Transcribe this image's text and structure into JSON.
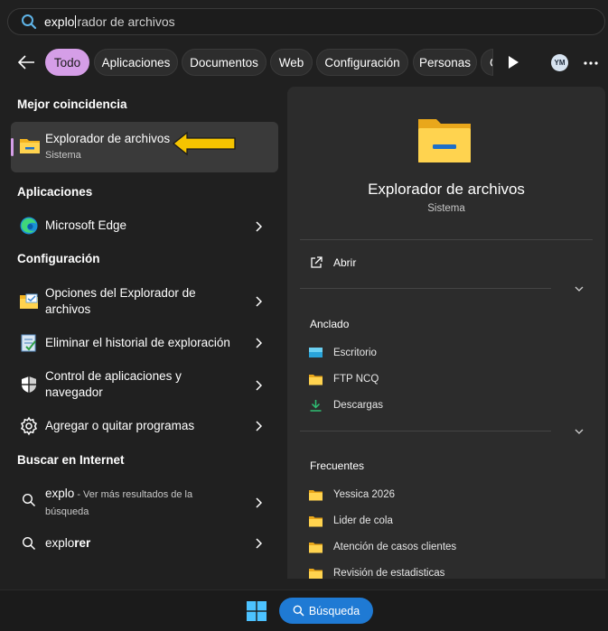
{
  "search": {
    "typed": "explo",
    "suggested_rest": "rador de archivos"
  },
  "filters": {
    "chips": [
      "Todo",
      "Aplicaciones",
      "Documentos",
      "Web",
      "Configuración",
      "Personas",
      "C"
    ],
    "active": "Todo",
    "avatar_initials": "YM"
  },
  "left": {
    "best_match_title": "Mejor coincidencia",
    "best_match": {
      "name": "Explorador de archivos",
      "type": "Sistema"
    },
    "apps_title": "Aplicaciones",
    "apps": [
      {
        "label": "Microsoft Edge",
        "icon": "edge-icon"
      }
    ],
    "settings_title": "Configuración",
    "settings": [
      {
        "line1": "Opciones del Explorador de",
        "line2": "archivos",
        "icon": "folder-options-icon"
      },
      {
        "line1": "Eliminar el historial de exploración",
        "line2": "",
        "icon": "clear-history-icon"
      },
      {
        "line1": "Control de aplicaciones y",
        "line2": "navegador",
        "icon": "shield-icon"
      },
      {
        "line1": "Agregar o quitar programas",
        "line2": "",
        "icon": "gear-icon"
      }
    ],
    "web_title": "Buscar en Internet",
    "web": [
      {
        "bold": "explo",
        "rest": " - Ver más resultados de la",
        "line2": "búsqueda"
      },
      {
        "normal": "explo",
        "bold": "rer"
      }
    ]
  },
  "right": {
    "title": "Explorador de archivos",
    "subtitle": "Sistema",
    "open_label": "Abrir",
    "pinned_title": "Anclado",
    "pinned": [
      "Escritorio",
      "FTP NCQ",
      "Descargas"
    ],
    "frequent_title": "Frecuentes",
    "frequent": [
      "Yessica 2026",
      "Lider de cola",
      "Atención de casos clientes",
      "Revisión de estadisticas"
    ]
  },
  "taskbar": {
    "search_label": "Búsqueda"
  },
  "colors": {
    "accent_chip": "#d59ee7",
    "folder_yellow": "#f8c73c",
    "taskbar_search": "#1f7ad4",
    "annotation_arrow": "#f5c400"
  }
}
